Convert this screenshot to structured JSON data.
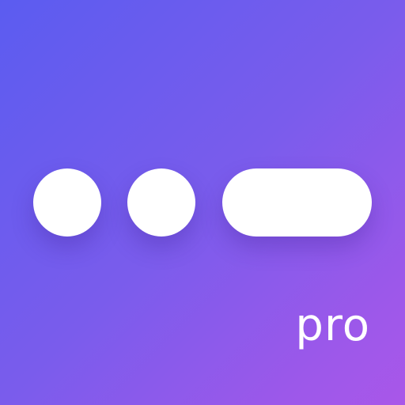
{
  "app_icon": {
    "label": "pro",
    "colors": {
      "gradient_start": "#5b5cf0",
      "gradient_end": "#a957e9",
      "foreground": "#ffffff"
    },
    "icons": [
      "dot-icon",
      "dot-icon",
      "pill-icon"
    ]
  }
}
